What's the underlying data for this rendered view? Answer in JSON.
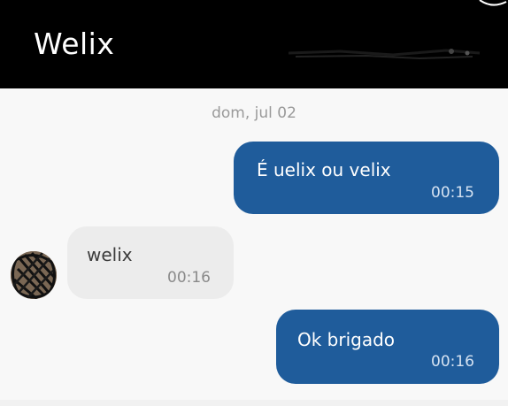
{
  "header": {
    "contact_name": "Welix",
    "background": "#000000"
  },
  "conversation": {
    "date_label": "dom, jul 02",
    "messages": [
      {
        "direction": "outgoing",
        "text": "É uelix ou velix",
        "time": "00:15"
      },
      {
        "direction": "incoming",
        "text": "welix",
        "time": "00:16"
      },
      {
        "direction": "outgoing",
        "text": "Ok brigado",
        "time": "00:16"
      }
    ]
  },
  "colors": {
    "outgoing_bubble": "#1f5c9b",
    "incoming_bubble": "#ececec",
    "background": "#f8f8f8"
  },
  "icons": {
    "avatar": "scribbled-avatar",
    "header_redaction": "scribble-redaction"
  }
}
